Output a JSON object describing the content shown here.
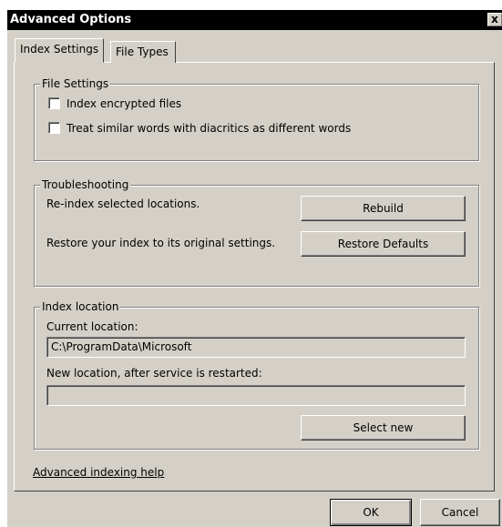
{
  "window": {
    "title": "Advanced Options",
    "close_glyph": "x"
  },
  "tabs": [
    {
      "label": "Index Settings",
      "selected": true
    },
    {
      "label": "File Types",
      "selected": false
    }
  ],
  "file_settings": {
    "title": "File Settings",
    "options": [
      {
        "label": "Index encrypted files",
        "checked": false
      },
      {
        "label": "Treat similar words with diacritics as different words",
        "checked": false
      }
    ]
  },
  "troubleshooting": {
    "title": "Troubleshooting",
    "reindex_text": "Re-index selected locations.",
    "rebuild_label": "Rebuild",
    "restore_text": "Restore your index to its original settings.",
    "restore_label": "Restore Defaults"
  },
  "index_location": {
    "title": "Index location",
    "current_label": "Current location:",
    "current_value": "C:\\ProgramData\\Microsoft",
    "new_label": "New location, after service is restarted:",
    "new_value": "",
    "select_new_label": "Select new"
  },
  "help_link": "Advanced indexing help",
  "footer": {
    "ok_label": "OK",
    "cancel_label": "Cancel"
  },
  "colors": {
    "dialog_face": "#d4d0c8",
    "titlebar": "#000000",
    "title_text": "#ffffff"
  }
}
